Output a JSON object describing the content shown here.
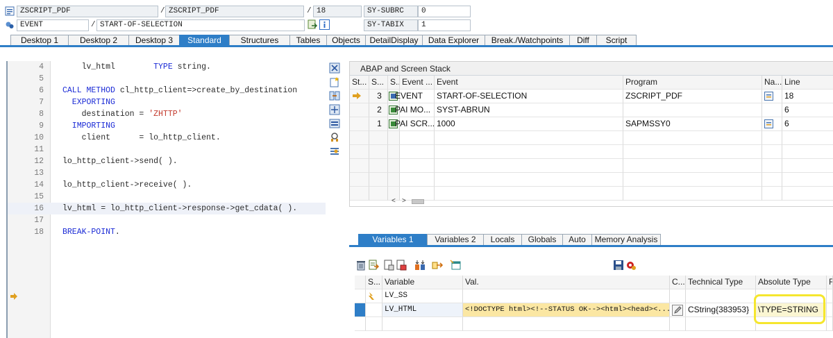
{
  "top_bar": {
    "row1": {
      "field1": "ZSCRIPT_PDF",
      "sep1": "/",
      "field2": "ZSCRIPT_PDF",
      "sep2": "/",
      "line": "18",
      "sys_field": "SY-SUBRC",
      "sys_value": "0"
    },
    "row2": {
      "field1": "EVENT",
      "sep1": "/",
      "field2": "START-OF-SELECTION",
      "sys_field": "SY-TABIX",
      "sys_value": "1"
    }
  },
  "main_tabs": [
    {
      "label": "Desktop 1"
    },
    {
      "label": "Desktop 2"
    },
    {
      "label": "Desktop 3"
    },
    {
      "label": "Standard"
    },
    {
      "label": "Structures"
    },
    {
      "label": "Tables"
    },
    {
      "label": "Objects"
    },
    {
      "label": "DetailDisplay"
    },
    {
      "label": "Data Explorer"
    },
    {
      "label": "Break./Watchpoints"
    },
    {
      "label": "Diff"
    },
    {
      "label": "Script"
    }
  ],
  "active_main_tab": "Standard",
  "code_lines": [
    {
      "num": "4",
      "segments": [
        [
          "",
          "    lv_html        "
        ],
        [
          "kw",
          "TYPE"
        ],
        [
          "",
          " string."
        ]
      ]
    },
    {
      "num": "5",
      "segments": []
    },
    {
      "num": "6",
      "segments": [
        [
          "kw",
          "CALL METHOD"
        ],
        [
          "",
          " cl_http_client=>create_by_destination"
        ]
      ]
    },
    {
      "num": "7",
      "segments": [
        [
          "kw",
          "  EXPORTING"
        ]
      ]
    },
    {
      "num": "8",
      "segments": [
        [
          "",
          "    destination = "
        ],
        [
          "str",
          "'ZHTTP'"
        ]
      ]
    },
    {
      "num": "9",
      "segments": [
        [
          "kw",
          "  IMPORTING"
        ]
      ]
    },
    {
      "num": "10",
      "segments": [
        [
          "",
          "    client      = lo_http_client."
        ]
      ]
    },
    {
      "num": "11",
      "segments": []
    },
    {
      "num": "12",
      "segments": [
        [
          "",
          "lo_http_client->send( )."
        ]
      ]
    },
    {
      "num": "13",
      "segments": []
    },
    {
      "num": "14",
      "segments": [
        [
          "",
          "lo_http_client->receive( )."
        ]
      ]
    },
    {
      "num": "15",
      "segments": []
    },
    {
      "num": "16",
      "segments": [
        [
          "",
          "lv_html = lo_http_client->response->get_cdata( )."
        ]
      ]
    },
    {
      "num": "17",
      "segments": []
    },
    {
      "num": "18",
      "segments": [
        [
          "kw",
          "BREAK-POINT"
        ],
        [
          "",
          "."
        ]
      ]
    }
  ],
  "stack": {
    "title": "ABAP and Screen Stack",
    "columns": [
      "St...",
      "S...",
      "S...",
      "Event ...",
      "Event",
      "Program",
      "Na...",
      "Line"
    ],
    "rows": [
      {
        "level": "3",
        "event_type": "EVENT",
        "event": "START-OF-SELECTION",
        "program": "ZSCRIPT_PDF",
        "line": "18",
        "current": true,
        "type_icon": "event-icon",
        "has_nav": true
      },
      {
        "level": "2",
        "event_type": "PAI MO...",
        "event": "SYST-ABRUN",
        "program": "",
        "line": "6",
        "current": false,
        "type_icon": "screen-icon",
        "has_nav": false
      },
      {
        "level": "1",
        "event_type": "PAI SCR...",
        "event": "1000",
        "program": "SAPMSSY0",
        "line": "6",
        "current": false,
        "type_icon": "screen-icon",
        "has_nav": true
      }
    ]
  },
  "var_tabs": [
    {
      "label": "Variables 1"
    },
    {
      "label": "Variables 2"
    },
    {
      "label": "Locals"
    },
    {
      "label": "Globals"
    },
    {
      "label": "Auto"
    },
    {
      "label": "Memory Analysis"
    }
  ],
  "active_var_tab": "Variables 1",
  "variables": {
    "columns": [
      "S...",
      "Variable",
      "Val.",
      "C...",
      "Technical Type",
      "Absolute Type",
      "R"
    ],
    "rows": [
      {
        "name": "LV_SS",
        "value": "",
        "tech_type": "",
        "abs_type": "",
        "selected": false
      },
      {
        "name": "LV_HTML",
        "value": "<!DOCTYPE html><!--STATUS OK--><html><head><...",
        "tech_type": "CString{383953}",
        "abs_type": "\\TYPE=STRING",
        "selected": true
      }
    ]
  },
  "colors": {
    "accent": "#2e7ec7",
    "highlight": "#f5e62e",
    "keyword": "#1b2bd6",
    "string": "#c43b2e",
    "selected_value_bg": "#fbe7a3"
  }
}
